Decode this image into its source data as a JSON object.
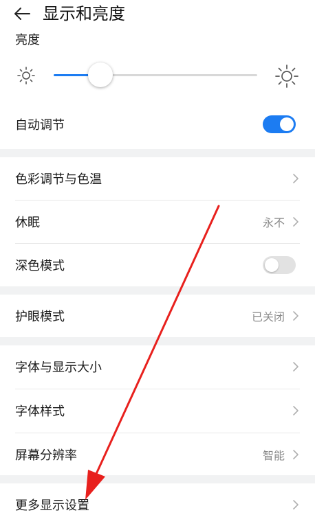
{
  "header": {
    "title": "显示和亮度",
    "back_icon": "arrow-left-icon"
  },
  "brightness": {
    "section_label": "亮度",
    "level": 0.23
  },
  "items": {
    "auto_adjust": {
      "label": "自动调节",
      "toggle_on": true
    },
    "color_temp": {
      "label": "色彩调节与色温"
    },
    "sleep": {
      "label": "休眠",
      "value": "永不"
    },
    "dark_mode": {
      "label": "深色模式",
      "toggle_on": false
    },
    "eye_comfort": {
      "label": "护眼模式",
      "value": "已关闭"
    },
    "font_display_size": {
      "label": "字体与显示大小"
    },
    "font_style": {
      "label": "字体样式"
    },
    "resolution": {
      "label": "屏幕分辨率",
      "value": "智能"
    },
    "more_display": {
      "label": "更多显示设置"
    }
  },
  "colors": {
    "accent": "#1c7cf2",
    "annotation_arrow": "#e8201d",
    "section_gap": "#f1f2f3"
  }
}
